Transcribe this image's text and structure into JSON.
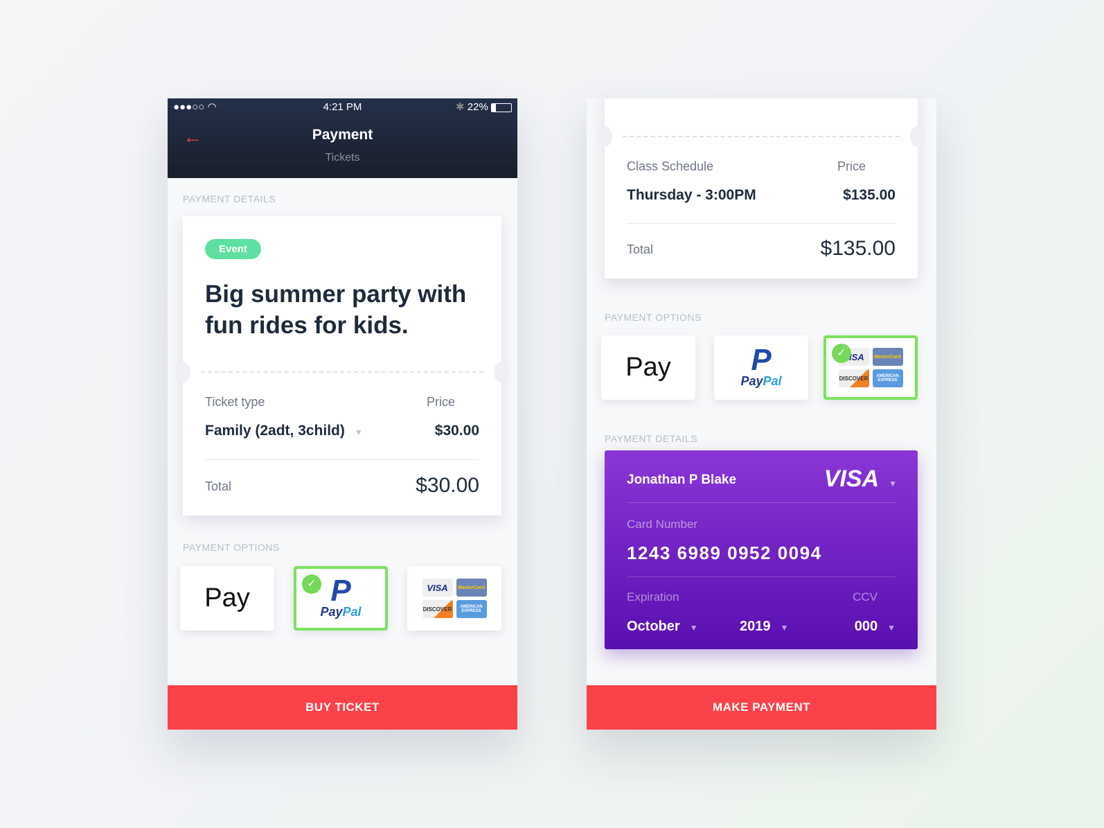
{
  "left": {
    "status": {
      "signal": "●●●○○",
      "wifi": "wifi-icon",
      "time": "4:21 PM",
      "bluetooth": "✱",
      "battery": "22%"
    },
    "header": {
      "title": "Payment",
      "subtitle": "Tickets"
    },
    "section_details": "PAYMENT DETAILS",
    "ticket": {
      "badge": "Event",
      "title": "Big summer party with fun rides for kids.",
      "type_label": "Ticket type",
      "type_value": "Family (2adt, 3child)",
      "price_label": "Price",
      "price_value": "$30.00",
      "total_label": "Total",
      "total_value": "$30.00"
    },
    "section_options": "PAYMENT OPTIONS",
    "options": {
      "apple": "Pay",
      "paypal_a": "Pay",
      "paypal_b": "Pal",
      "selected": "paypal"
    },
    "button": "BUY TICKET"
  },
  "right": {
    "summary": {
      "schedule_label": "Class Schedule",
      "schedule_value": "Thursday - 3:00PM",
      "price_label": "Price",
      "price_value": "$135.00",
      "total_label": "Total",
      "total_value": "$135.00"
    },
    "section_options": "PAYMENT OPTIONS",
    "options": {
      "apple": "Pay",
      "paypal_a": "Pay",
      "paypal_b": "Pal",
      "selected": "cards"
    },
    "section_details": "PAYMENT DETAILS",
    "card": {
      "name": "Jonathan P Blake",
      "brand": "VISA",
      "number_label": "Card Number",
      "number": "1243 6989 0952 0094",
      "exp_label": "Expiration",
      "month": "October",
      "year": "2019",
      "ccv_label": "CCV",
      "ccv": "000"
    },
    "button": "MAKE PAYMENT"
  },
  "card_logos": {
    "visa": "VISA",
    "mastercard": "MasterCard",
    "discover": "DISCOVER",
    "amex": "AMERICAN EXPRESS"
  },
  "colors": {
    "accent": "#fb4149",
    "selected": "#7be25f",
    "badge": "#5ee0a0",
    "card": "#7a2ccd"
  }
}
